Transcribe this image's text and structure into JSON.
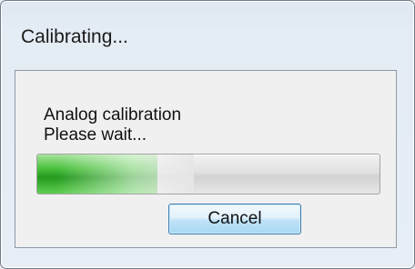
{
  "dialog": {
    "title": "Calibrating...",
    "message_line1": "Analog calibration",
    "message_line2": "Please wait...",
    "progress": 0.35,
    "cancel_label": "Cancel"
  },
  "colors": {
    "progress_fill": "#2faa28",
    "window_frame": "#dfe8f1",
    "button_border": "#3c7fb1"
  }
}
